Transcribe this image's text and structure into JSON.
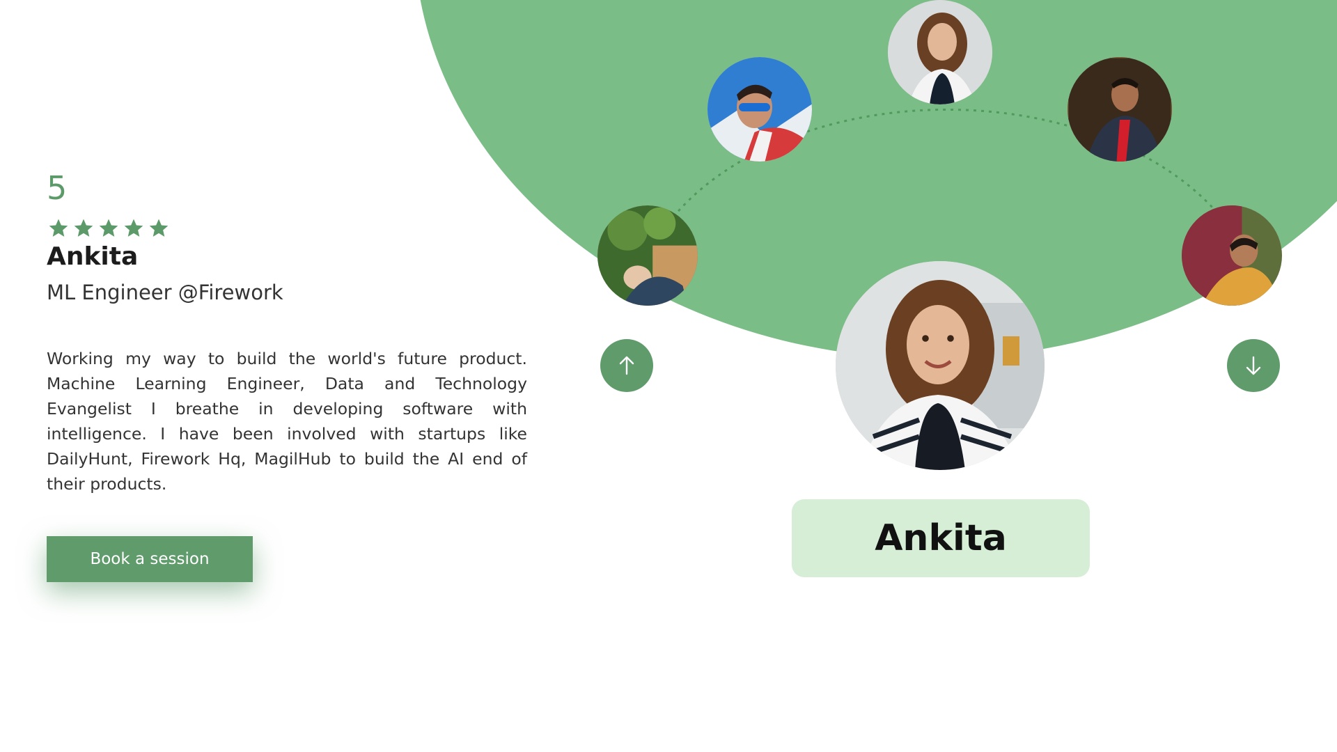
{
  "profile": {
    "rating": "5",
    "stars_filled": 5,
    "stars_total": 5,
    "name": "Ankita",
    "role": "ML Engineer @Firework",
    "bio": "Working my way to build the world's future product. Machine Learning Engineer, Data and Technology Evangelist I breathe in developing software with intelligence. I have been involved with startups like DailyHunt, Firework Hq, MagilHub to build the AI end of their products."
  },
  "cta": {
    "book_label": "Book a session"
  },
  "carousel": {
    "selected_name": "Ankita",
    "avatars": [
      {
        "id": "avatar-left-low",
        "icon": "person-photo-icon"
      },
      {
        "id": "avatar-left-high",
        "icon": "person-photo-icon"
      },
      {
        "id": "avatar-top",
        "icon": "person-photo-icon"
      },
      {
        "id": "avatar-right-high",
        "icon": "person-photo-icon"
      },
      {
        "id": "avatar-right-low",
        "icon": "person-photo-icon"
      }
    ],
    "prev_icon": "arrow-up-icon",
    "next_icon": "arrow-down-icon"
  },
  "colors": {
    "accent": "#5f9b6b",
    "disc": "#7bbd86",
    "name_card": "#d5eed5",
    "rating": "#5c9a6a"
  }
}
